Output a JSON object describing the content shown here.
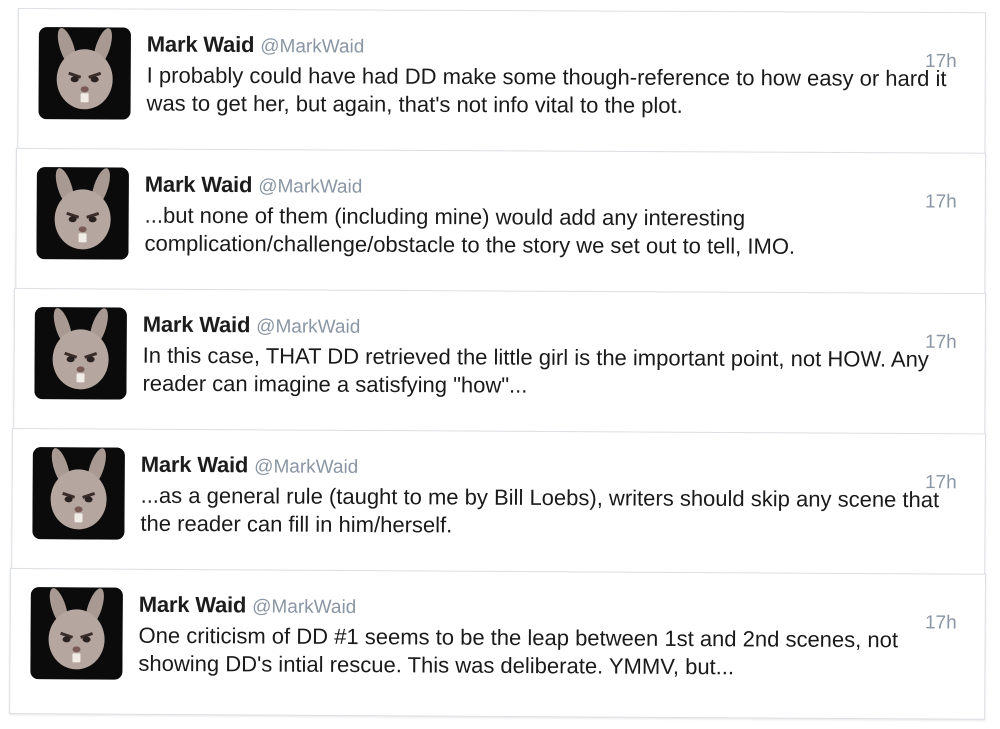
{
  "feed": {
    "tweets": [
      {
        "author_name": "Mark Waid",
        "author_handle": "@MarkWaid",
        "time": "17h",
        "text": "I probably could have had DD make some though-reference to how easy or hard it was to get her, but again, that's not info vital to the plot."
      },
      {
        "author_name": "Mark Waid",
        "author_handle": "@MarkWaid",
        "time": "17h",
        "text": "...but none of them (including mine) would add any interesting complication/challenge/obstacle to the story we set out to tell, IMO."
      },
      {
        "author_name": "Mark Waid",
        "author_handle": "@MarkWaid",
        "time": "17h",
        "text": "In this case, THAT DD retrieved the little girl is the important point, not HOW. Any reader can imagine a satisfying \"how\"..."
      },
      {
        "author_name": "Mark Waid",
        "author_handle": "@MarkWaid",
        "time": "17h",
        "text": "...as a general rule (taught to me by Bill Loebs), writers should skip any scene that the reader can fill in him/herself."
      },
      {
        "author_name": "Mark Waid",
        "author_handle": "@MarkWaid",
        "time": "17h",
        "text": "One criticism of DD #1 seems to be the leap between 1st and 2nd scenes, not showing DD's intial rescue. This was deliberate. YMMV, but..."
      }
    ]
  }
}
